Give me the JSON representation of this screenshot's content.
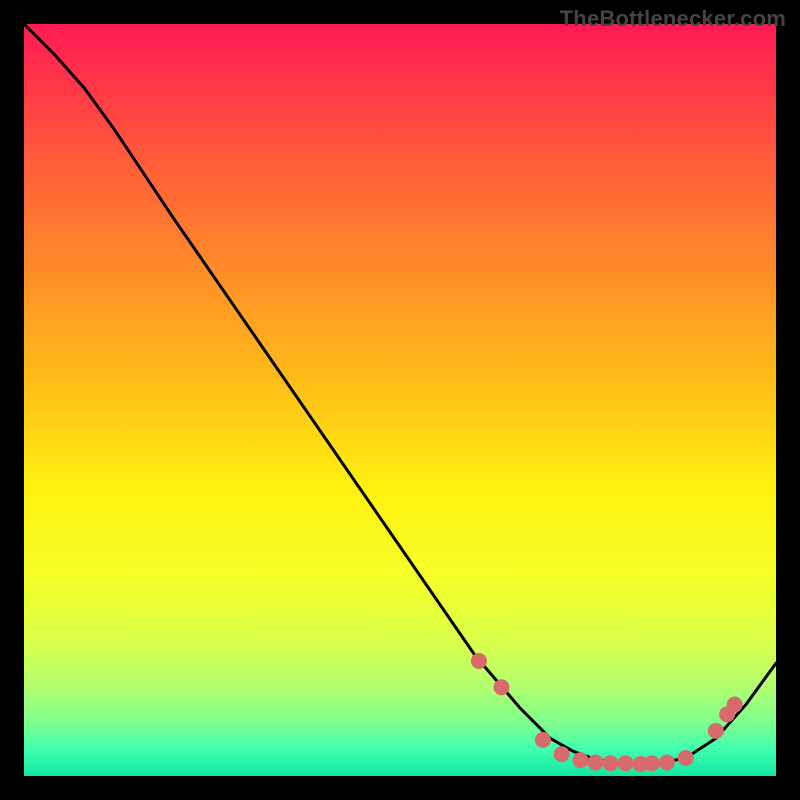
{
  "attribution": "TheBottlenecker.com",
  "chart_data": {
    "type": "line",
    "title": "",
    "xlabel": "",
    "ylabel": "",
    "xlim": [
      0,
      100
    ],
    "ylim": [
      0,
      100
    ],
    "grid": false,
    "legend": false,
    "gradient_stops": [
      {
        "offset": 0,
        "color": "#ff1a52"
      },
      {
        "offset": 0.06,
        "color": "#ff2f4b"
      },
      {
        "offset": 0.18,
        "color": "#ff5b3a"
      },
      {
        "offset": 0.32,
        "color": "#ff8a2a"
      },
      {
        "offset": 0.48,
        "color": "#ffbf18"
      },
      {
        "offset": 0.62,
        "color": "#fff210"
      },
      {
        "offset": 0.74,
        "color": "#f4ff28"
      },
      {
        "offset": 0.82,
        "color": "#d9ff4a"
      },
      {
        "offset": 0.88,
        "color": "#b3ff6e"
      },
      {
        "offset": 0.93,
        "color": "#7dff8f"
      },
      {
        "offset": 0.965,
        "color": "#3fffb0"
      },
      {
        "offset": 1.0,
        "color": "#12e6a3"
      }
    ],
    "series": [
      {
        "name": "bottleneck-curve",
        "color": "#000000",
        "x": [
          0,
          4,
          8,
          12,
          16,
          20,
          30,
          40,
          50,
          60,
          66,
          70,
          73,
          76,
          80,
          84,
          88,
          92,
          96,
          100
        ],
        "y": [
          100,
          96,
          91.5,
          86,
          80,
          74,
          59.5,
          45,
          30.5,
          16,
          9,
          5,
          3.3,
          2.2,
          1.7,
          1.6,
          2.4,
          5,
          9.5,
          15
        ]
      }
    ],
    "markers": {
      "name": "marker-dots",
      "color": "#d76a6a",
      "radius": 8,
      "points": [
        {
          "x": 60.5,
          "y": 15.3
        },
        {
          "x": 63.5,
          "y": 11.8
        },
        {
          "x": 69.0,
          "y": 4.8
        },
        {
          "x": 71.5,
          "y": 2.9
        },
        {
          "x": 74.0,
          "y": 2.1
        },
        {
          "x": 76.0,
          "y": 1.8
        },
        {
          "x": 78.0,
          "y": 1.7
        },
        {
          "x": 80.0,
          "y": 1.7
        },
        {
          "x": 82.0,
          "y": 1.6
        },
        {
          "x": 83.5,
          "y": 1.7
        },
        {
          "x": 85.5,
          "y": 1.8
        },
        {
          "x": 88.0,
          "y": 2.4
        },
        {
          "x": 92.0,
          "y": 6.0
        },
        {
          "x": 93.5,
          "y": 8.2
        },
        {
          "x": 94.5,
          "y": 9.5
        }
      ]
    }
  }
}
